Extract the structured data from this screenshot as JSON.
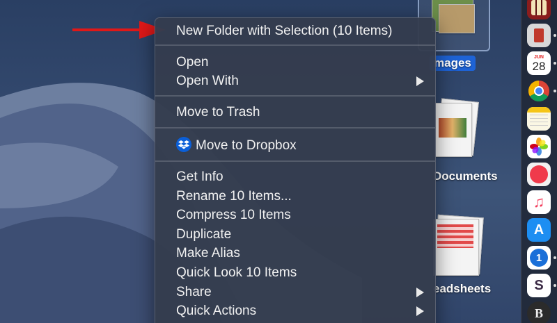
{
  "desktop": {
    "stacks": [
      {
        "label": "Images",
        "label_display": "mages",
        "selected": true
      },
      {
        "label": "Documents"
      },
      {
        "label": "Spreadsheets",
        "label_display": "eadsheets"
      }
    ]
  },
  "dock": {
    "apps": [
      {
        "name": "photo-booth-icon"
      },
      {
        "name": "pdf-app-icon"
      },
      {
        "name": "calendar-icon",
        "month": "JUN",
        "day": "28"
      },
      {
        "name": "chrome-icon"
      },
      {
        "name": "notes-icon"
      },
      {
        "name": "photos-icon"
      },
      {
        "name": "news-icon"
      },
      {
        "name": "music-icon"
      },
      {
        "name": "app-store-icon"
      },
      {
        "name": "1password-icon",
        "glyph": "1"
      },
      {
        "name": "slack-icon",
        "glyph": "S"
      },
      {
        "name": "bbedit-icon",
        "glyph": "B"
      }
    ]
  },
  "context_menu": {
    "items": [
      {
        "label": "New Folder with Selection (10 Items)"
      },
      {
        "label": "Open"
      },
      {
        "label": "Open With"
      },
      {
        "label": "Move to Trash"
      },
      {
        "label": "Move to Dropbox"
      },
      {
        "label": "Get Info"
      },
      {
        "label": "Rename 10 Items..."
      },
      {
        "label": "Compress 10 Items"
      },
      {
        "label": "Duplicate"
      },
      {
        "label": "Make Alias"
      },
      {
        "label": "Quick Look 10 Items"
      },
      {
        "label": "Share"
      },
      {
        "label": "Quick Actions"
      }
    ]
  },
  "colors": {
    "menu_bg": "#343c4e",
    "arrow": "#e01818",
    "selection": "#1e63d6"
  }
}
